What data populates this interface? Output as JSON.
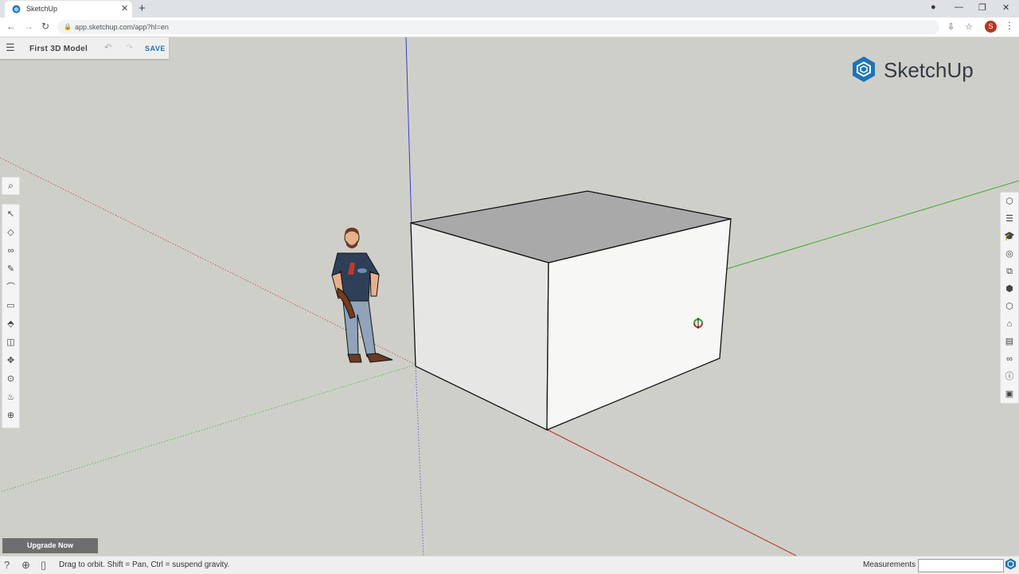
{
  "browser": {
    "tab_title": "SketchUp",
    "url": "app.sketchup.com/app?hl=en",
    "profile_initial": "S"
  },
  "app": {
    "model_name": "First 3D Model",
    "save_label": "SAVE",
    "logo_text": "SketchUp",
    "upgrade_label": "Upgrade Now"
  },
  "left_toolbar": {
    "tools": [
      "select-icon",
      "eraser-icon",
      "lasso-icon",
      "pencil-icon",
      "arc-icon",
      "rectangle-icon",
      "push-pull-icon",
      "offset-icon",
      "move-icon",
      "tape-measure-icon",
      "paint-bucket-icon",
      "orbit-icon"
    ]
  },
  "right_toolbar": {
    "panels": [
      "entity-info-icon",
      "layers-icon",
      "instructor-icon",
      "materials-icon",
      "components-icon",
      "solid-icon",
      "views-icon",
      "tags-icon",
      "scenes-icon",
      "styles-icon",
      "model-info-icon",
      "export-icon"
    ]
  },
  "statusbar": {
    "hint": "Drag to orbit. Shift = Pan, Ctrl = suspend gravity.",
    "measurements_label": "Measurements",
    "measurements_value": ""
  },
  "colors": {
    "axis_red": "#b0342d",
    "axis_green": "#3dab2c",
    "axis_blue": "#3b3bd0",
    "accent_blue": "#1d74b7",
    "background": "#cfcfca"
  }
}
